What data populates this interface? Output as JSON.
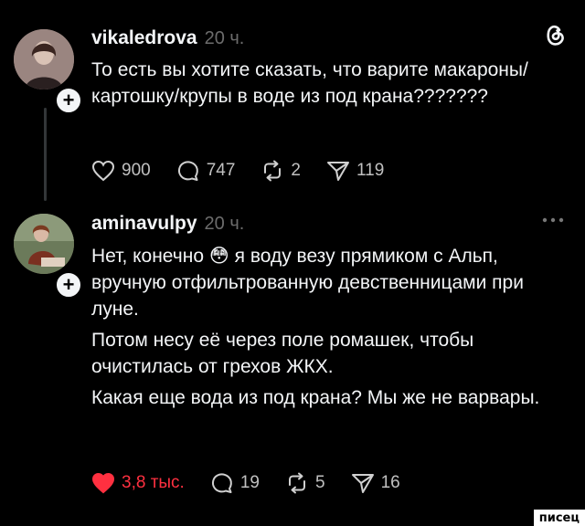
{
  "posts": [
    {
      "username": "vikaledrova",
      "time": "20 ч.",
      "text": [
        "То есть вы хотите сказать, что варите макароны/картошку/крупы в воде из под крана???????"
      ],
      "likes": "900",
      "comments": "747",
      "reposts": "2",
      "shares": "119",
      "liked": false
    },
    {
      "username": "aminavulpy",
      "time": "20 ч.",
      "text_line1_a": "Нет, конечно",
      "text_emoji": "😳",
      "text_line1_b": "я воду везу прямиком с Альп, вручную отфильтрованную девственницами при луне.",
      "text_p2": "Потом несу её через поле ромашек, чтобы очистилась от грехов ЖКХ.",
      "text_p3": "Какая еще вода из под крана? Мы же не варвары.",
      "likes": "3,8 тыс.",
      "comments": "19",
      "reposts": "5",
      "shares": "16",
      "liked": true
    }
  ],
  "watermark": "писец",
  "icons": {
    "app_logo": "threads-logo-icon",
    "more": "more-dots-icon",
    "like": "heart-icon",
    "comment": "comment-bubble-icon",
    "repost": "repost-icon",
    "share": "send-icon",
    "follow": "plus-icon"
  },
  "colors": {
    "background": "#000000",
    "text": "#f3f5f7",
    "muted": "#6c6c6c",
    "like_active": "#ff3040"
  }
}
